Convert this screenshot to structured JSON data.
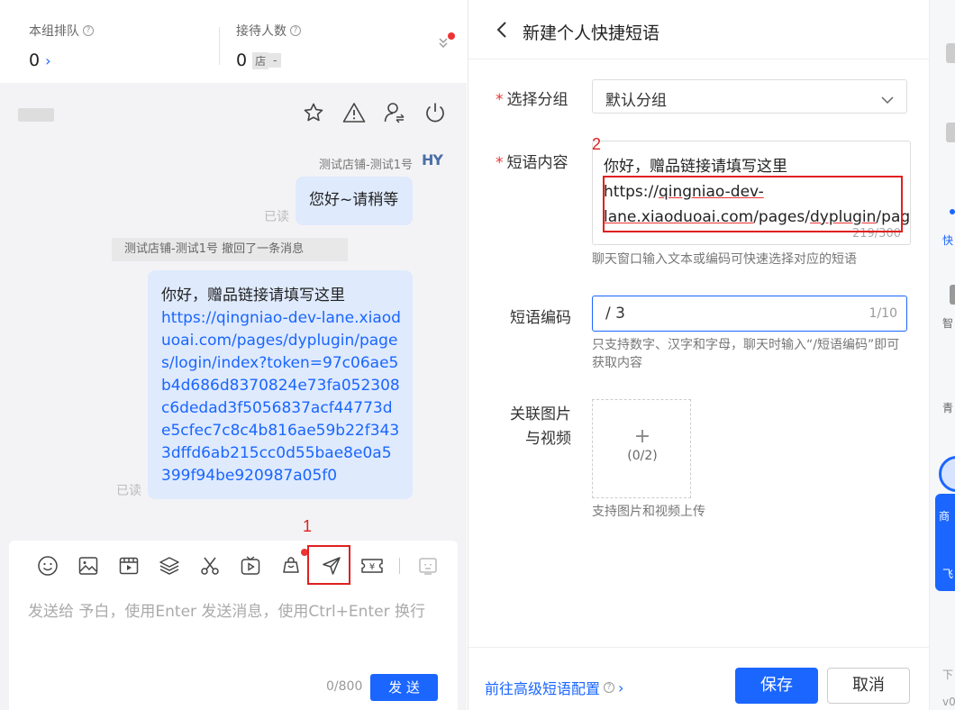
{
  "queue": {
    "label": "本组排队",
    "value": "0"
  },
  "reception": {
    "label": "接待人数",
    "value": "0",
    "store_tag": "店",
    "dash_tag": "-"
  },
  "chat": {
    "agent_name": "测试店铺-测试1号",
    "agent_avatar_text": "HY",
    "msg1": "您好~请稍等",
    "read_label": "已读",
    "recall_notice": "测试店铺-测试1号 撤回了一条消息",
    "msg2_text": "你好，赠品链接请填写这里",
    "msg2_link": "https://qingniao-dev-lane.xiaoduoai.com/pages/dyplugin/pages/login/index?token=97c06ae5b4d686d8370824e73fa052308c6dedad3f5056837acf44773de5cfec7c8c4b816ae59b22f3433dffd6ab215cc0d55bae8e0a5399f94be920987a05f0"
  },
  "markers": {
    "m1": "1",
    "m2": "2"
  },
  "input": {
    "placeholder": "发送给 予白，使用Enter 发送消息，使用Ctrl+Enter 换行",
    "counter": "0/800",
    "send_label": "发 送"
  },
  "panel": {
    "title": "新建个人快捷短语",
    "group_label": "选择分组",
    "group_value": "默认分组",
    "content_label": "短语内容",
    "content_line1": "你好，赠品链接请填写这里",
    "content_link_a": "https://",
    "content_link_b": "qingniao-dev-",
    "content_link_c": "lane.xiaoduoai.com",
    "content_link_d": "/pages/",
    "content_link_e": "dyplugin",
    "content_link_f": "/page",
    "content_count": "219/300",
    "content_hint": "聊天窗口输入文本或编码可快速选择对应的短语",
    "code_label": "短语编码",
    "code_value": "/ 3",
    "code_count": "1/10",
    "code_hint": "只支持数字、汉字和字母，聊天时输入“/短语编码”即可获取内容",
    "media_label_1": "关联图片",
    "media_label_2": "与视频",
    "media_plus": "+",
    "media_count": "(0/2)",
    "media_hint": "支持图片和视频上传",
    "adv_link": "前往高级短语配置",
    "save_label": "保存",
    "cancel_label": "取消"
  },
  "right_strip": {
    "items": [
      "快",
      "智",
      "青",
      "商",
      "飞",
      "下",
      "v0"
    ]
  },
  "colors": {
    "accent": "#1a66ff",
    "bubble": "#dfeafd",
    "marker": "#e02020"
  }
}
